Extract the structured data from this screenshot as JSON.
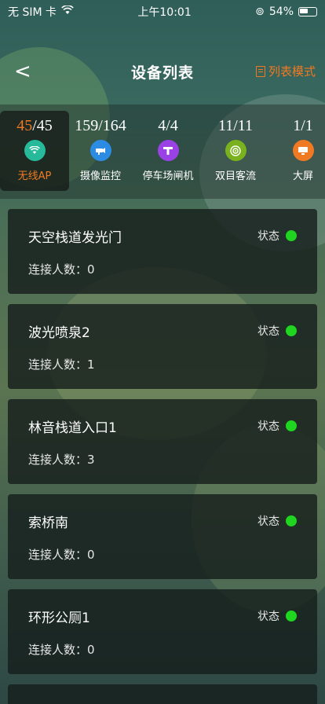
{
  "status_bar": {
    "carrier": "无 SIM 卡",
    "time": "上午10:01",
    "battery": "54%"
  },
  "nav": {
    "back": "<",
    "title": "设备列表",
    "mode": "列表模式"
  },
  "categories": [
    {
      "current": "45",
      "total": "/45",
      "label": "无线AP",
      "icon": "wifi-icon",
      "color": "#26b99a"
    },
    {
      "current": "159",
      "total": "/164",
      "label": "摄像监控",
      "icon": "camera-icon",
      "color": "#2c8be3"
    },
    {
      "current": "4",
      "total": "/4",
      "label": "停车场闸机",
      "icon": "gate-icon",
      "color": "#9a42e6"
    },
    {
      "current": "11",
      "total": "/11",
      "label": "双目客流",
      "icon": "binocular-icon",
      "color": "#7ab11f"
    },
    {
      "current": "1",
      "total": "/1",
      "label": "大屏",
      "icon": "screen-icon",
      "color": "#f07a23"
    }
  ],
  "devices": [
    {
      "name": "天空栈道发光门",
      "status_label": "状态",
      "connections": "连接人数：0"
    },
    {
      "name": "波光喷泉2",
      "status_label": "状态",
      "connections": "连接人数：1"
    },
    {
      "name": "林音栈道入口1",
      "status_label": "状态",
      "connections": "连接人数：3"
    },
    {
      "name": "索桥南",
      "status_label": "状态",
      "connections": "连接人数：0"
    },
    {
      "name": "环形公厕1",
      "status_label": "状态",
      "connections": "连接人数：0"
    }
  ],
  "colors": {
    "accent": "#f07a23",
    "online": "#1fd520"
  }
}
